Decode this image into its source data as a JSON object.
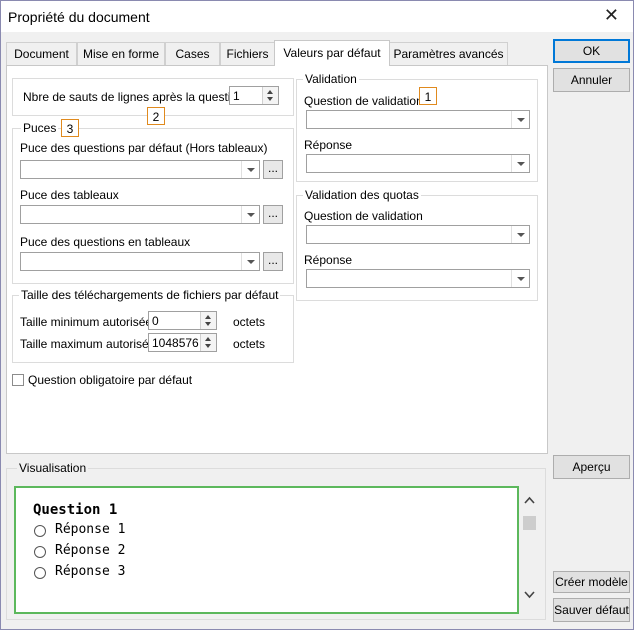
{
  "window": {
    "title": "Propriété du document",
    "close_glyph": "✕"
  },
  "tabs": [
    {
      "label": "Document"
    },
    {
      "label": "Mise en forme"
    },
    {
      "label": "Cases"
    },
    {
      "label": "Fichiers"
    },
    {
      "label": "Valeurs par défaut",
      "active": true
    },
    {
      "label": "Paramètres avancés"
    }
  ],
  "buttons": {
    "ok": "OK",
    "cancel": "Annuler",
    "preview": "Aperçu",
    "create_model": "Créer modèle",
    "save_default": "Sauver défaut"
  },
  "line_breaks": {
    "label": "Nbre de sauts de lignes après la question :",
    "value": "1"
  },
  "badges": {
    "one": "1",
    "two": "2",
    "three": "3"
  },
  "bullets": {
    "legend": "Puces",
    "default_label": "Puce des questions par défaut (Hors tableaux)",
    "tables_label": "Puce des tableaux",
    "in_tables_label": "Puce des questions en tableaux",
    "browse": "..."
  },
  "uploads": {
    "legend": "Taille des téléchargements de fichiers par défaut",
    "min_label": "Taille minimum autorisée",
    "min_value": "0",
    "max_label": "Taille maximum autorisée",
    "max_value": "1048576",
    "unit": "octets"
  },
  "mandatory": {
    "label": "Question obligatoire par défaut",
    "checked": false
  },
  "validation": {
    "legend": "Validation",
    "question_label": "Question de validation",
    "answer_label": "Réponse"
  },
  "quota_validation": {
    "legend": "Validation des quotas",
    "question_label": "Question de validation",
    "answer_label": "Réponse"
  },
  "visualisation": {
    "legend": "Visualisation",
    "question": "Question 1",
    "answers": [
      "Réponse 1",
      "Réponse 2",
      "Réponse 3"
    ]
  },
  "colors": {
    "preview_border": "#5cb85c",
    "badge_border": "#e08a1e",
    "primary_border": "#0078d7"
  }
}
